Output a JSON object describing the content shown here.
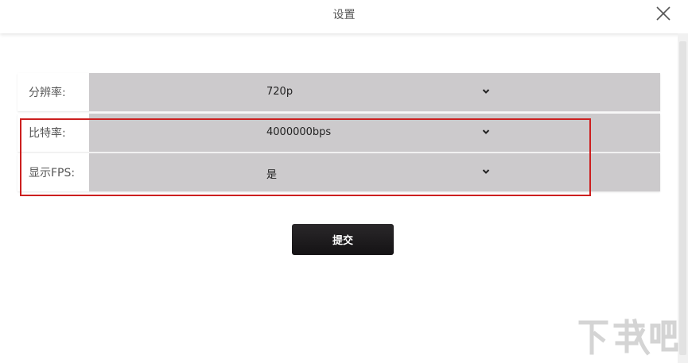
{
  "dialog": {
    "title": "设置"
  },
  "form": {
    "rows": [
      {
        "label": "分辨率:",
        "value": "720p"
      },
      {
        "label": "比特率:",
        "value": "4000000bps"
      },
      {
        "label": "显示FPS:",
        "value": "是"
      }
    ],
    "submit_label": "提交"
  },
  "colors": {
    "select_background": "#cccacc",
    "highlight_border": "#cc1f1f",
    "submit_background": "#1c1a1c"
  },
  "icons": {
    "close": "close-icon",
    "dropdown": "chevron-down-icon",
    "watermark": "xiazaiba-watermark-logo"
  },
  "watermark": {
    "text": "下载吧"
  }
}
